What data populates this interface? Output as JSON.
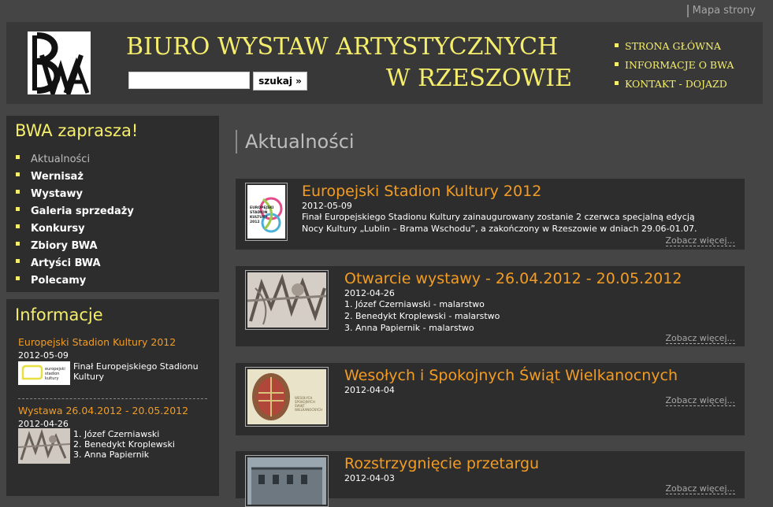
{
  "topbar": {
    "sitemap": "Mapa strony"
  },
  "header": {
    "title_line1": "BIURO WYSTAW ARTYSTYCZNYCH",
    "title_line2": "W RZESZOWIE",
    "search_placeholder": "",
    "search_button": "szukaj »",
    "nav": [
      "STRONA GŁÓWNA",
      "INFORMACJE O BWA",
      "KONTAKT - DOJAZD"
    ]
  },
  "sidebar": {
    "zaprasza_title": "BWA zaprasza!",
    "menu": [
      "Aktualności",
      "Wernisaż",
      "Wystawy",
      "Galeria sprzedaży",
      "Konkursy",
      "Zbiory BWA",
      "Artyści BWA",
      "Polecamy"
    ],
    "info_title": "Informacje",
    "info_items": [
      {
        "title": "Europejski Stadion Kultury 2012",
        "date": "2012-05-09",
        "text": [
          "Finał Europejskiego Stadionu",
          "Kultury"
        ]
      },
      {
        "title": "Wystawa 26.04.2012 - 20.05.2012",
        "date": "2012-04-26",
        "text": [
          "1. Józef Czerniawski",
          "2. Benedykt Kroplewski",
          "3. Anna Papiernik"
        ]
      }
    ]
  },
  "main": {
    "title": "Aktualności",
    "more_label": "Zobacz więcej...",
    "news": [
      {
        "title": "Europejski Stadion Kultury 2012",
        "date": "2012-05-09",
        "desc": [
          "Finał Europejskiego Stadionu Kultury zainaugurowany zostanie 2 czerwca specjalną edycją",
          "Nocy Kultury „Lublin – Brama Wschodu”, a zakończony w Rzeszowie w dniach 29.06-01.07."
        ]
      },
      {
        "title": "Otwarcie wystawy - 26.04.2012 - 20.05.2012",
        "date": "2012-04-26",
        "desc": [
          "1. Józef Czerniawski - malarstwo",
          "2. Benedykt Kroplewski - malarstwo",
          "3. Anna Papiernik - malarstwo"
        ]
      },
      {
        "title": "Wesołych i Spokojnych Świąt Wielkanocnych",
        "date": "2012-04-04",
        "desc": []
      },
      {
        "title": "Rozstrzygnięcie przetargu",
        "date": "2012-04-03",
        "desc": []
      }
    ]
  },
  "thumb_text": {
    "esk_poster": [
      "EUROPEJSKI",
      "STADION",
      "KULTURY",
      "2012"
    ],
    "easter_card": [
      "WESOŁYCH",
      "SPOKOJNYCH",
      "ŚWIĄT",
      "WIELKANOCNYCH"
    ],
    "info_esk_logo": [
      "europejski",
      "stadion",
      "kultury"
    ]
  },
  "colors": {
    "accent_yellow": "#f5ee6c",
    "accent_orange": "#f39c23",
    "background": "#454545",
    "panel": "#2d2d2d"
  }
}
